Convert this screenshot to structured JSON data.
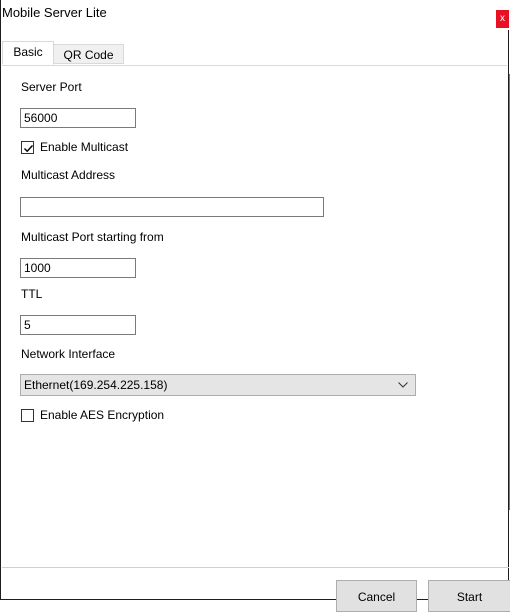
{
  "window": {
    "title": "Mobile Server Lite",
    "close_glyph": "x",
    "close_color": "#e81123"
  },
  "tabs": [
    {
      "label": "Basic",
      "selected": true
    },
    {
      "label": "QR Code",
      "selected": false
    }
  ],
  "basic": {
    "server_port_label": "Server Port",
    "server_port_value": "56000",
    "enable_multicast_label": "Enable Multicast",
    "enable_multicast_checked": true,
    "multicast_address_label": "Multicast Address",
    "multicast_address_value": "",
    "multicast_port_label": "Multicast Port starting from",
    "multicast_port_value": "1000",
    "ttl_label": "TTL",
    "ttl_value": "5",
    "network_interface_label": "Network Interface",
    "network_interface_value": "Ethernet(169.254.225.158)",
    "enable_aes_label": "Enable AES Encryption",
    "enable_aes_checked": false
  },
  "footer": {
    "cancel_label": "Cancel",
    "start_label": "Start"
  },
  "icons": {
    "checkmark": "check-icon",
    "dropdown": "chevron-down-icon"
  }
}
